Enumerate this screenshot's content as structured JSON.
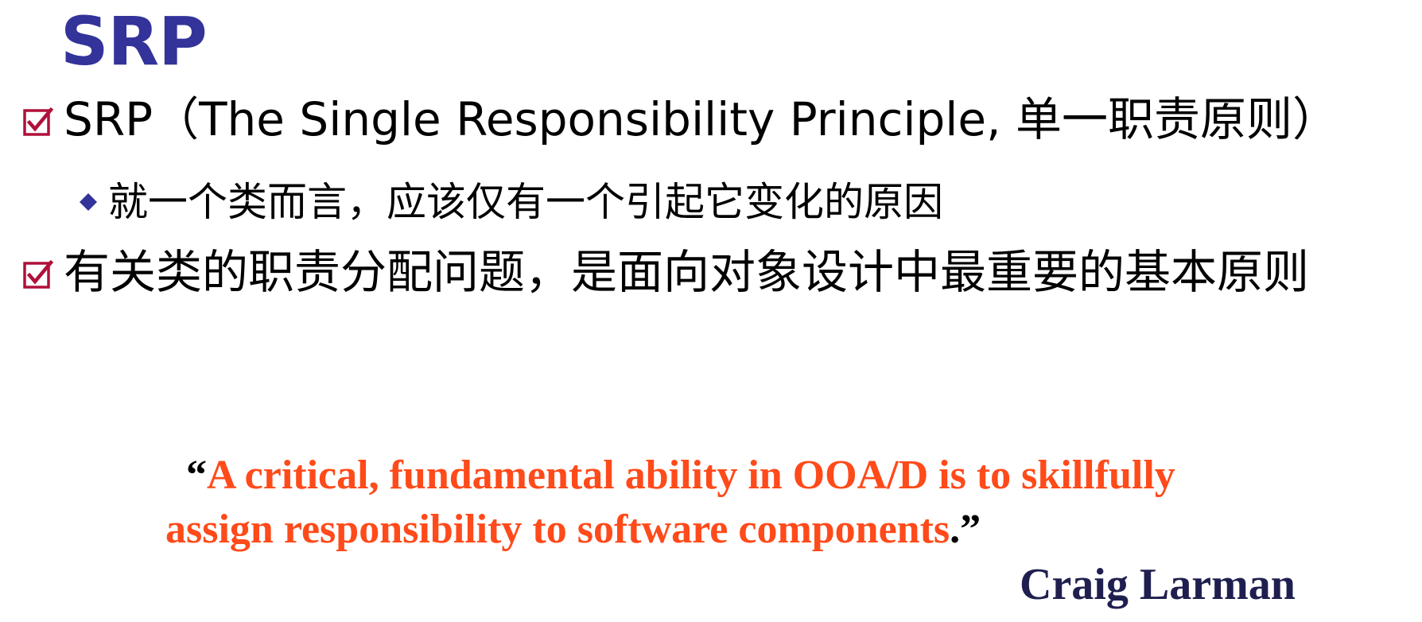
{
  "slide": {
    "title": "SRP",
    "title_color": "#33339a",
    "bullets": [
      {
        "icon": "checkbox-icon",
        "text": "SRP（The Single Responsibility Principle, 单一职责原则）",
        "sub": [
          {
            "icon": "diamond-icon",
            "text": "就一个类而言，应该仅有一个引起它变化的原因"
          }
        ]
      },
      {
        "icon": "checkbox-icon",
        "text": "有关类的职责分配问题，是面向对象设计中最重要的基本原则"
      }
    ],
    "quote": {
      "open_mark": "“",
      "line1": "A critical, fundamental ability in OOA/D is to skillfully",
      "line2": "assign responsibility to software components",
      "period": ".",
      "close_mark": "”",
      "text_color": "#ff4a1a"
    },
    "author": "Craig Larman",
    "author_color": "#1f1f4f",
    "bullet_color": "#b0103a",
    "sub_bullet_color": "#33339a"
  }
}
